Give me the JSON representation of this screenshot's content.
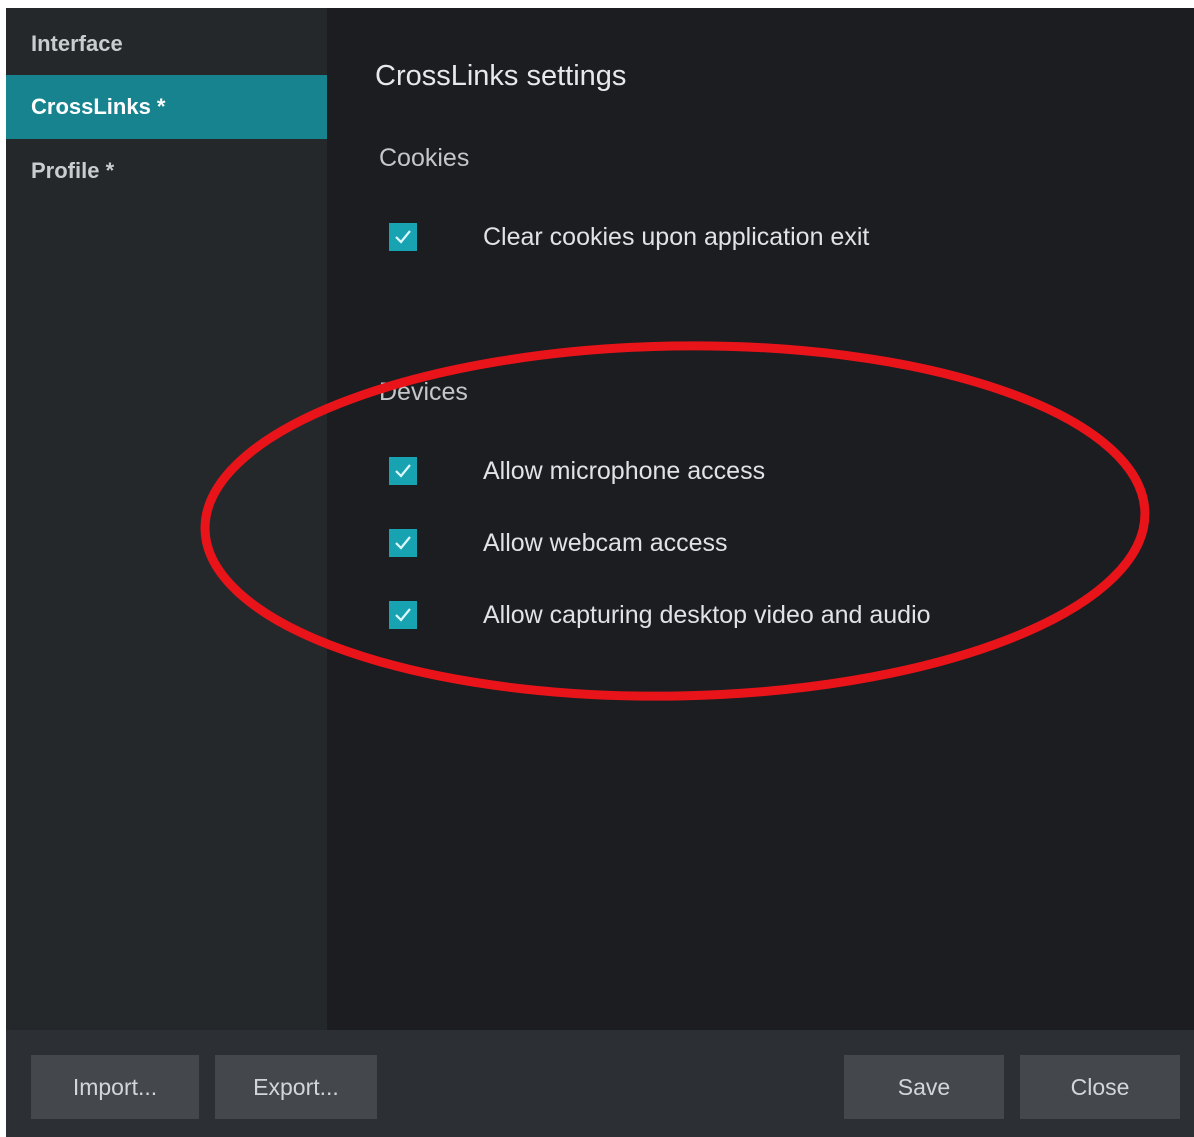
{
  "sidebar": {
    "items": [
      {
        "label": "Interface",
        "active": false
      },
      {
        "label": "CrossLinks *",
        "active": true
      },
      {
        "label": "Profile *",
        "active": false
      }
    ]
  },
  "main": {
    "title": "CrossLinks settings",
    "sections": [
      {
        "title": "Cookies",
        "options": [
          {
            "label": "Clear cookies upon application exit",
            "checked": true
          }
        ]
      },
      {
        "title": "Devices",
        "options": [
          {
            "label": "Allow microphone access",
            "checked": true
          },
          {
            "label": "Allow webcam access",
            "checked": true
          },
          {
            "label": "Allow capturing desktop video and audio",
            "checked": true
          }
        ]
      }
    ]
  },
  "footer": {
    "import_label": "Import...",
    "export_label": "Export...",
    "save_label": "Save",
    "close_label": "Close"
  },
  "colors": {
    "accent": "#16838f",
    "checkbox": "#17a3b2",
    "annotation": "#e8141a",
    "background": "#1b1d20",
    "sidebar": "#25282b"
  }
}
